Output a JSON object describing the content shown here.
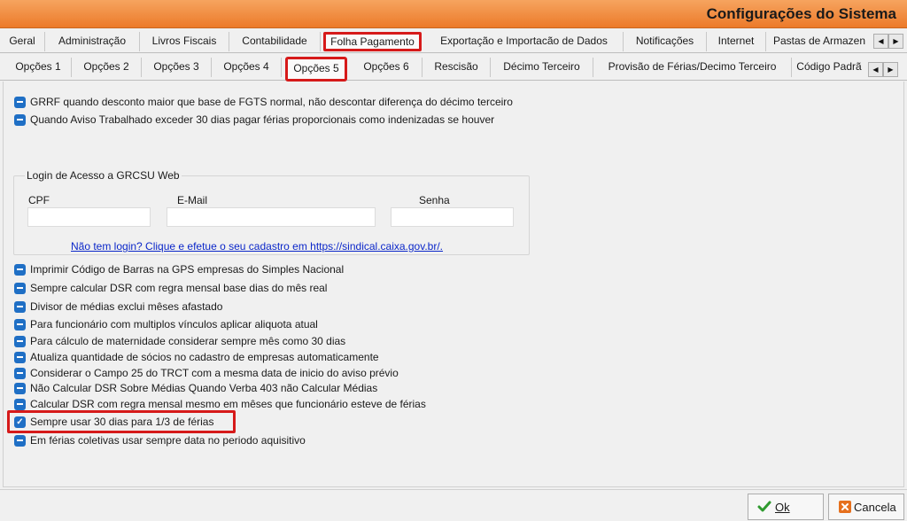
{
  "window": {
    "title": "Configurações do Sistema"
  },
  "tabs_main": [
    "Geral",
    "Administração",
    "Livros Fiscais",
    "Contabilidade",
    "Folha Pagamento",
    "Exportação e Importacão de Dados",
    "Notificações",
    "Internet",
    "Pastas de Armazen"
  ],
  "tabs_sub": [
    "Opções 1",
    "Opções 2",
    "Opções 3",
    "Opções 4",
    "Opções 5",
    "Opções 6",
    "Rescisão",
    "Décimo Terceiro",
    "Provisão de Férias/Decimo Terceiro",
    "Código Padrã"
  ],
  "options_top": [
    "GRRF quando desconto maior que base de FGTS normal, não descontar diferença do décimo terceiro",
    "Quando Aviso Trabalhado exceder 30 dias pagar férias  proporcionais como indenizadas se houver"
  ],
  "login_group": {
    "legend": "Login de Acesso a GRCSU Web",
    "cpf_label": "CPF",
    "email_label": "E-Mail",
    "senha_label": "Senha",
    "cpf_value": "",
    "email_value": "",
    "senha_value": "",
    "link": "Não tem login? Clique e efetue o seu cadastro em https://sindical.caixa.gov.br/."
  },
  "options_bottom": [
    "Imprimir Código de Barras na GPS empresas do Simples Nacional",
    "Sempre calcular DSR com regra mensal base dias do mês real",
    "Divisor de médias exclui mêses afastado",
    "Para funcionário com multiplos vínculos aplicar aliquota atual",
    "Para cálculo de maternidade considerar sempre mês como 30 dias",
    "Atualiza quantidade de sócios no cadastro de empresas automaticamente",
    "Considerar o Campo 25 do TRCT com a mesma data de inicio do aviso prévio",
    "Não Calcular DSR Sobre Médias Quando Verba 403 não Calcular Médias",
    "Calcular DSR com regra mensal mesmo em mêses que funcionário esteve de férias",
    "Sempre usar 30 dias para 1/3 de férias",
    "Em férias coletivas usar sempre data  no periodo aquisitivo"
  ],
  "buttons": {
    "ok": "Ok",
    "cancel": "Cancela"
  },
  "colors": {
    "title_bar": "#ec7a2a",
    "highlight": "#d61a1a",
    "checkbox": "#1f6fc5",
    "link": "#0b27c9"
  }
}
